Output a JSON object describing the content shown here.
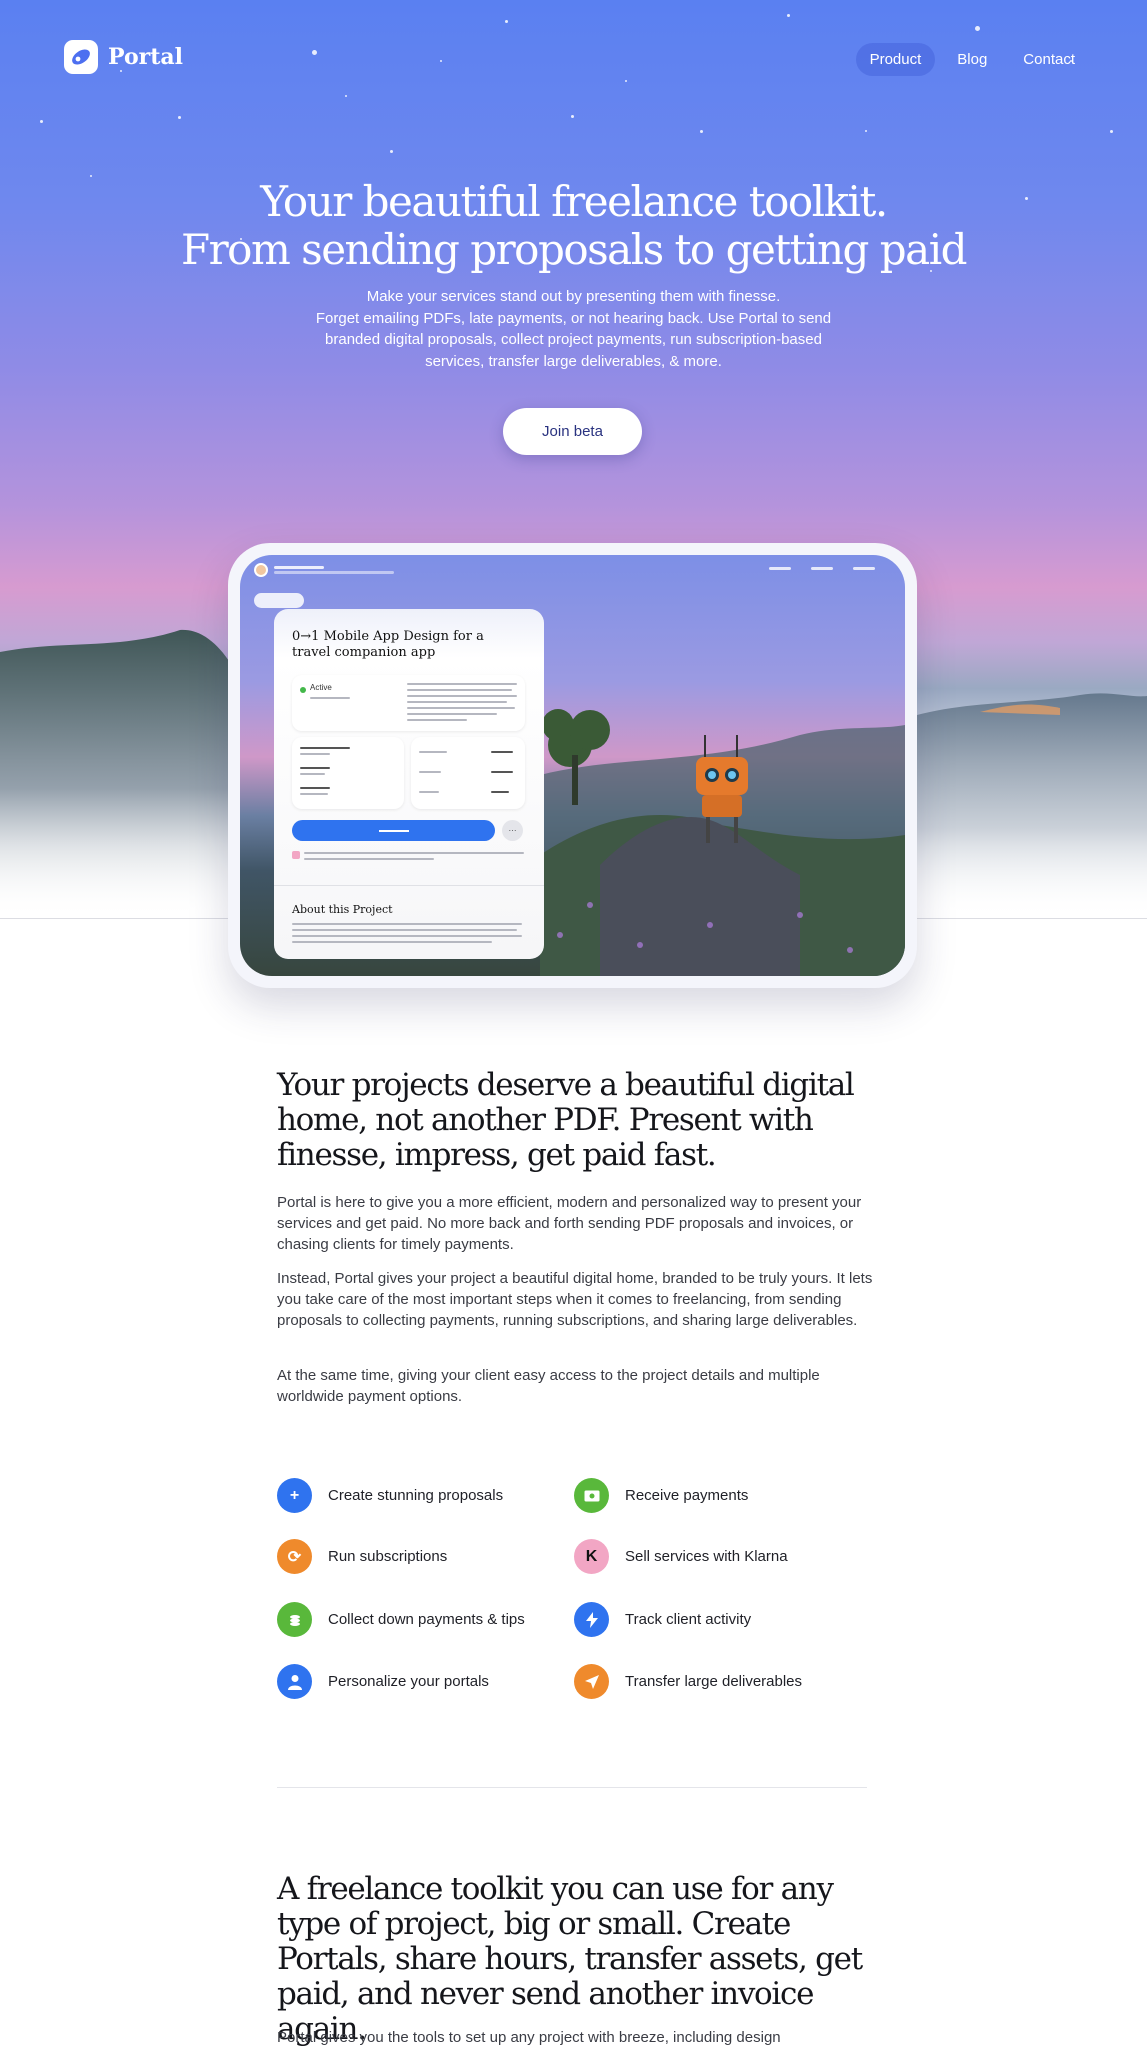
{
  "nav": {
    "logo_text": "Portal",
    "links": [
      {
        "label": "Product",
        "active": true
      },
      {
        "label": "Blog",
        "active": false
      },
      {
        "label": "Contact",
        "active": false
      }
    ]
  },
  "hero": {
    "title_line1": "Your beautiful freelance toolkit.",
    "title_line2": "From sending proposals to getting paid",
    "sub_line1": "Make your services stand out by presenting them with finesse.",
    "sub_line2": "Forget emailing PDFs, late payments, or not hearing back. Use Portal to send",
    "sub_line3": "branded digital proposals, collect project payments, run subscription-based",
    "sub_line4": "services, transfer large deliverables, & more.",
    "cta_label": "Join beta"
  },
  "preview": {
    "card_title": "0→1 Mobile App Design for a travel companion app",
    "status": "Active",
    "about_title": "About this Project"
  },
  "section1": {
    "title": "Your projects deserve a beautiful digital home, not another PDF. Present with finesse, impress, get paid fast.",
    "p1": "Portal is here to give you a more efficient, modern and personalized way to present your services and get paid. No more back and forth sending PDF proposals and invoices, or chasing clients for timely payments.",
    "p2": "Instead, Portal gives your project a beautiful digital home, branded to be truly yours. It lets you take care of the most important steps when it comes to freelancing, from sending proposals to collecting payments, running subscriptions, and sharing large deliverables.",
    "p3": "At the same time, giving your client easy access to the project details and multiple worldwide payment options."
  },
  "features": [
    {
      "label": "Create stunning proposals",
      "icon": "plus-icon",
      "color": "#2f73ef",
      "glyph": "+"
    },
    {
      "label": "Receive payments",
      "icon": "cash-icon",
      "color": "#59b83b",
      "glyph": "$"
    },
    {
      "label": "Run subscriptions",
      "icon": "refresh-icon",
      "color": "#ef8a2c",
      "glyph": "⟳"
    },
    {
      "label": "Sell services with Klarna",
      "icon": "klarna-icon",
      "color": "#f2a6c4",
      "glyph": "K"
    },
    {
      "label": "Collect down payments & tips",
      "icon": "coins-icon",
      "color": "#59b83b",
      "glyph": "≡"
    },
    {
      "label": "Track client activity",
      "icon": "bolt-icon",
      "color": "#2f73ef",
      "glyph": "ϟ"
    },
    {
      "label": "Personalize your portals",
      "icon": "person-icon",
      "color": "#2f73ef",
      "glyph": "●"
    },
    {
      "label": "Transfer large deliverables",
      "icon": "send-icon",
      "color": "#ef8a2c",
      "glyph": "➤"
    }
  ],
  "section2": {
    "title": "A freelance toolkit you can use for any type of project, big or small. Create Portals, share hours, transfer assets, get paid, and never send another invoice again.",
    "p1": "Portal gives you the tools to set up any project with breeze, including design"
  }
}
